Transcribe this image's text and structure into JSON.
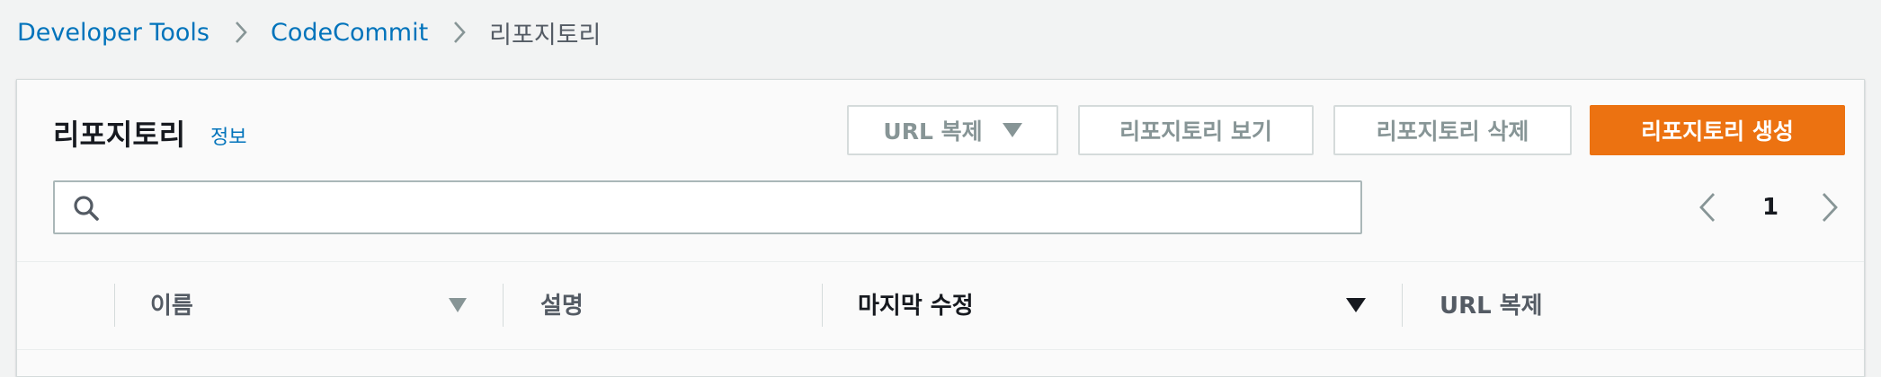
{
  "breadcrumb": {
    "items": [
      "Developer Tools",
      "CodeCommit"
    ],
    "current": "리포지토리"
  },
  "panel": {
    "title": "리포지토리",
    "info_link": "정보"
  },
  "toolbar": {
    "clone_url_label": "URL 복제",
    "view_label": "리포지토리 보기",
    "delete_label": "리포지토리 삭제",
    "create_label": "리포지토리 생성"
  },
  "search": {
    "value": "",
    "placeholder": ""
  },
  "pagination": {
    "current_page": "1"
  },
  "table": {
    "columns": [
      "이름",
      "설명",
      "마지막 수정",
      "URL 복제"
    ],
    "sorted_column": "마지막 수정"
  },
  "colors": {
    "primary": "#ec7211",
    "link": "#0073bb",
    "background": "#f2f3f3"
  },
  "icons": [
    "chevron-right-icon",
    "caret-down-icon",
    "search-icon",
    "chevron-left-icon",
    "sort-icon"
  ]
}
